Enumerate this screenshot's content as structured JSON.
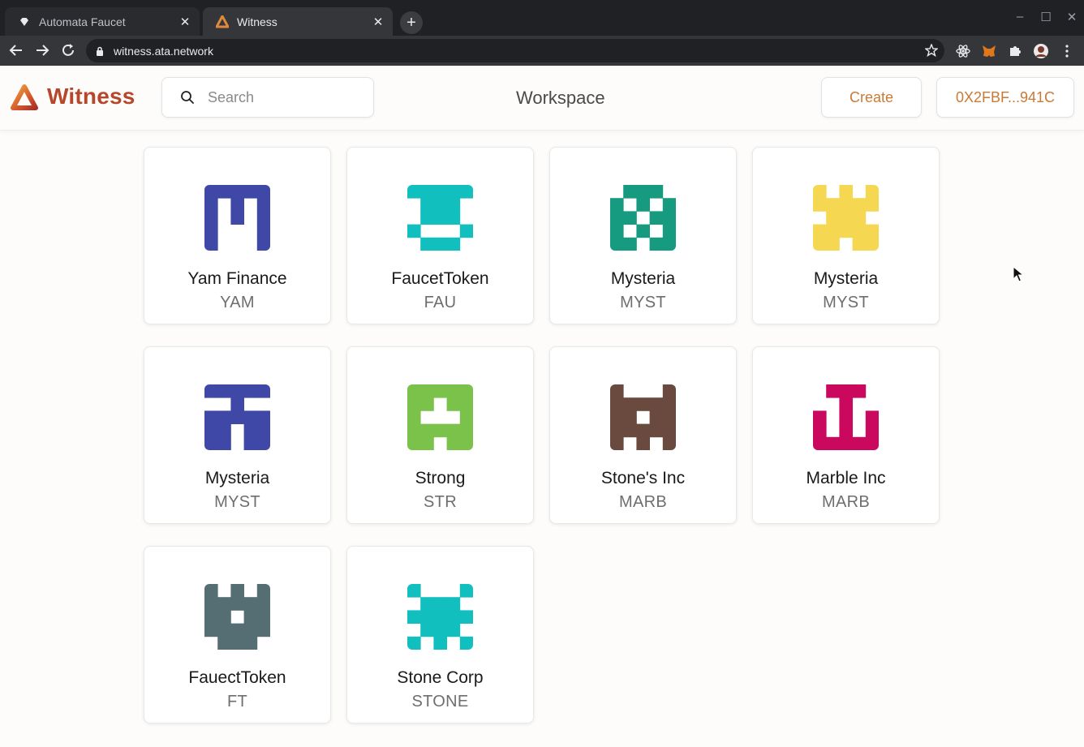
{
  "browser": {
    "tabs": [
      {
        "title": "Automata Faucet",
        "active": false
      },
      {
        "title": "Witness",
        "active": true
      }
    ],
    "url": "witness.ata.network"
  },
  "header": {
    "brand": "Witness",
    "search_placeholder": "Search",
    "workspace_label": "Workspace",
    "create_label": "Create",
    "wallet_label": "0X2FBF...941C",
    "brand_color": "#b5482a",
    "accent_color": "#c97a35"
  },
  "tokens": [
    {
      "name": "Yam Finance",
      "symbol": "YAM",
      "color": "#3f48a6",
      "pattern": [
        "11111",
        "10101",
        "10101",
        "10001",
        "10001"
      ]
    },
    {
      "name": "FaucetToken",
      "symbol": "FAU",
      "color": "#12bfbf",
      "pattern": [
        "11111",
        "01110",
        "01110",
        "10001",
        "01110"
      ]
    },
    {
      "name": "Mysteria",
      "symbol": "MYST",
      "color": "#169b80",
      "pattern": [
        "01110",
        "10101",
        "11011",
        "10101",
        "11011"
      ]
    },
    {
      "name": "Mysteria",
      "symbol": "MYST",
      "color": "#f5d752",
      "pattern": [
        "10101",
        "11111",
        "01110",
        "11111",
        "11011"
      ]
    },
    {
      "name": "Mysteria",
      "symbol": "MYST",
      "color": "#3f48a6",
      "pattern": [
        "11111",
        "00100",
        "11111",
        "11011",
        "11011"
      ]
    },
    {
      "name": "Strong",
      "symbol": "STR",
      "color": "#7bc24a",
      "pattern": [
        "11111",
        "11011",
        "10001",
        "11111",
        "11011"
      ]
    },
    {
      "name": "Stone's Inc",
      "symbol": "MARB",
      "color": "#6a4a3f",
      "pattern": [
        "10001",
        "11111",
        "11011",
        "11111",
        "10101"
      ]
    },
    {
      "name": "Marble Inc",
      "symbol": "MARB",
      "color": "#c9085e",
      "pattern": [
        "01110",
        "00100",
        "10101",
        "10101",
        "11111"
      ]
    },
    {
      "name": "FauectToken",
      "symbol": "FT",
      "color": "#546e73",
      "pattern": [
        "10101",
        "11111",
        "11011",
        "11111",
        "01110"
      ]
    },
    {
      "name": "Stone Corp",
      "symbol": "STONE",
      "color": "#12bfbf",
      "pattern": [
        "10001",
        "01110",
        "11111",
        "01110",
        "10101"
      ]
    }
  ]
}
